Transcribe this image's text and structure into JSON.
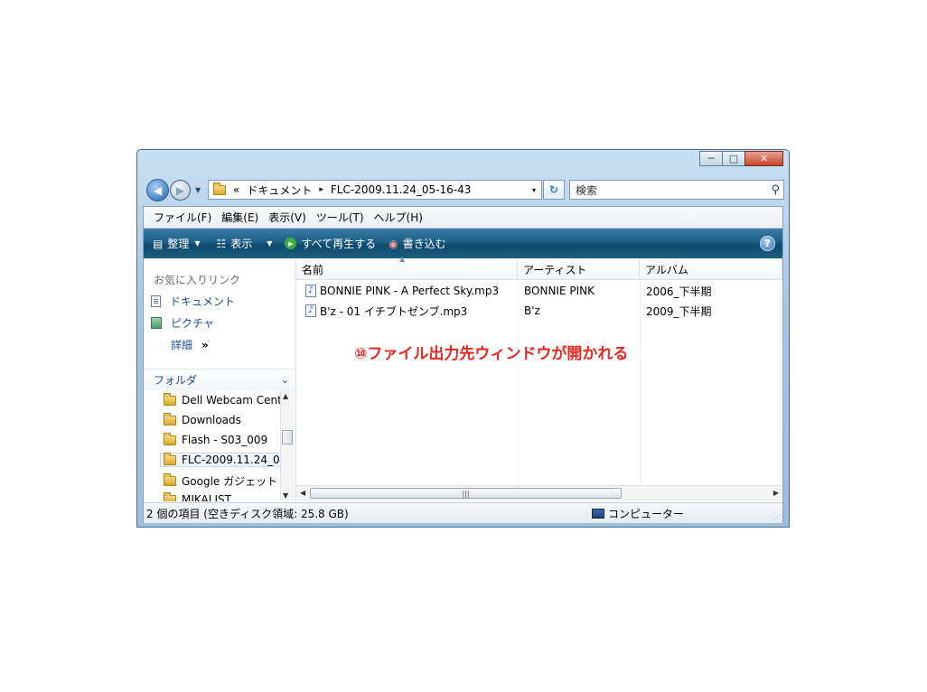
{
  "window": {
    "buttons": {
      "minimize": "─",
      "maximize": "□",
      "close": "✕"
    }
  },
  "nav": {
    "address": {
      "prefix": "«",
      "segment1": "ドキュメント",
      "separator": "▸",
      "segment2": "FLC-2009.11.24_05-16-43",
      "dropdown": "▾"
    },
    "search_placeholder": "検索"
  },
  "menu": [
    "ファイル(F)",
    "編集(E)",
    "表示(V)",
    "ツール(T)",
    "ヘルプ(H)"
  ],
  "toolbar": {
    "organize": "整理",
    "views": "表示",
    "play_all": "すべて再生する",
    "burn": "書き込む"
  },
  "sidebar": {
    "favorites_title": "お気に入りリンク",
    "favorites": [
      "ドキュメント",
      "ピクチャ"
    ],
    "more": "詳細",
    "more_chevron": "»",
    "folders_title": "フォルダ",
    "tree": [
      "Dell Webcam Cent",
      "Downloads",
      "Flash - S03_009",
      "FLC-2009.11.24_0",
      "Google ガジェット",
      "MIKALIST"
    ]
  },
  "columns": [
    "名前",
    "アーティスト",
    "アルバム"
  ],
  "files": [
    {
      "name": "BONNIE PINK - A Perfect Sky.mp3",
      "artist": "BONNIE PINK",
      "album": "2006_下半期"
    },
    {
      "name": "B'z - 01 イチブトゼンブ.mp3",
      "artist": "B'z",
      "album": "2009_下半期"
    }
  ],
  "annotation": "⑩ファイル出力先ウィンドウが開かれる",
  "status": {
    "left": "2 個の項目 (空きディスク領域: 25.8 GB)",
    "right": "コンピューター"
  },
  "hscroll_thumb": "|||"
}
